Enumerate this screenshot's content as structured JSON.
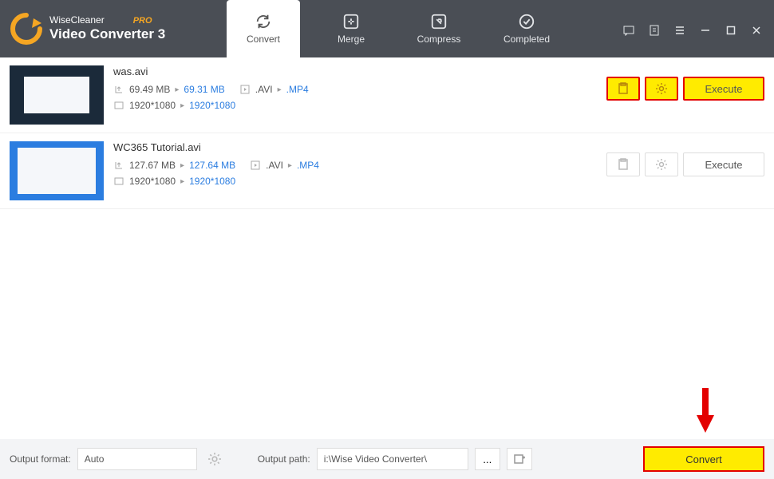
{
  "app": {
    "brand": "WiseCleaner",
    "pro": "PRO",
    "title": "Video Converter 3"
  },
  "tabs": {
    "convert": "Convert",
    "merge": "Merge",
    "compress": "Compress",
    "completed": "Completed"
  },
  "items": [
    {
      "filename": "was.avi",
      "size_in": "69.49 MB",
      "size_out": "69.31 MB",
      "fmt_in": ".AVI",
      "fmt_out": ".MP4",
      "res_in": "1920*1080",
      "res_out": "1920*1080",
      "exec": "Execute",
      "highlighted": true
    },
    {
      "filename": "WC365 Tutorial.avi",
      "size_in": "127.67 MB",
      "size_out": "127.64 MB",
      "fmt_in": ".AVI",
      "fmt_out": ".MP4",
      "res_in": "1920*1080",
      "res_out": "1920*1080",
      "exec": "Execute",
      "highlighted": false
    }
  ],
  "footer": {
    "format_label": "Output format:",
    "format_value": "Auto",
    "path_label": "Output path:",
    "path_value": "i:\\Wise Video Converter\\",
    "browse": "...",
    "convert": "Convert"
  }
}
